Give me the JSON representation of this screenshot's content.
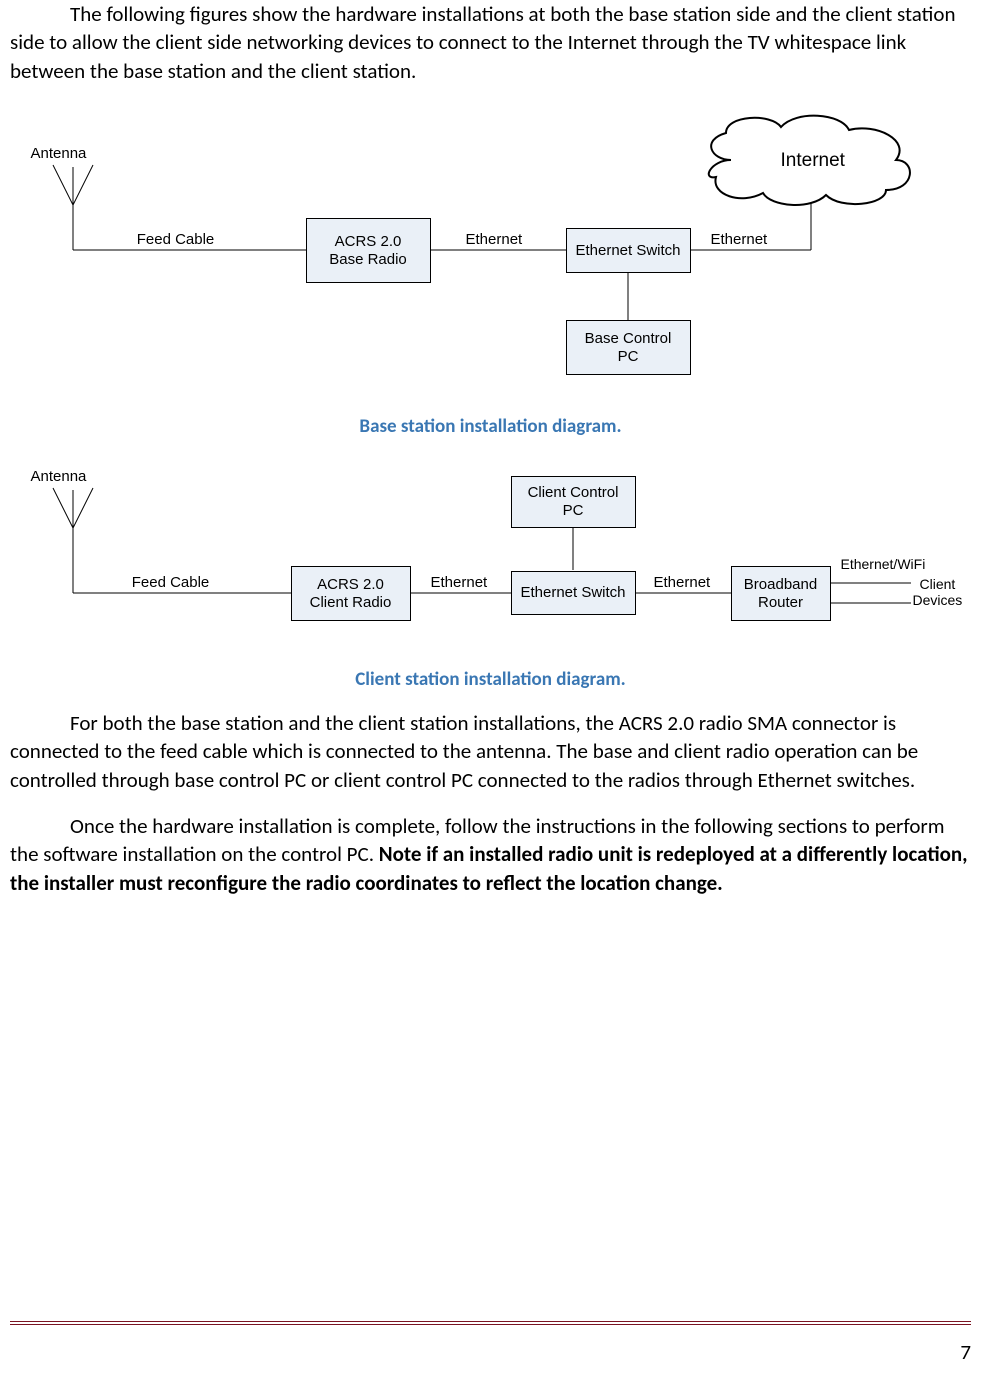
{
  "paragraphs": {
    "p1": "The following figures show the hardware installations at both the base station side and the client station side to allow the client side networking devices to connect to the Internet through the TV whitespace link between the base station and the client station.",
    "p2": "For both the base station and the client station installations, the ACRS 2.0 radio SMA connector is connected to the feed cable which is connected to the antenna. The base and client radio operation can be controlled through base control PC or client control PC connected to the radios through Ethernet switches.",
    "p3_a": "Once the hardware installation is complete, follow the instructions in the following sections to perform the software installation on the control PC. ",
    "p3_b": "Note if an installed radio unit is redeployed at a differently location, the installer must reconfigure the radio coordinates to reflect the location change."
  },
  "captions": {
    "c1": "Base station installation diagram.",
    "c2": "Client station installation diagram."
  },
  "diagram1": {
    "labels": {
      "antenna": "Antenna",
      "feed_cable": "Feed Cable",
      "ethernet1": "Ethernet",
      "ethernet2": "Ethernet",
      "internet": "Internet"
    },
    "nodes": {
      "base_radio": "ACRS 2.0\nBase Radio",
      "eth_switch": "Ethernet Switch",
      "base_pc": "Base Control\nPC"
    }
  },
  "diagram2": {
    "labels": {
      "antenna": "Antenna",
      "feed_cable": "Feed Cable",
      "ethernet1": "Ethernet",
      "ethernet2": "Ethernet",
      "eth_wifi": "Ethernet/WiFi",
      "client_devices": "Client\nDevices"
    },
    "nodes": {
      "client_radio": "ACRS 2.0\nClient Radio",
      "eth_switch": "Ethernet Switch",
      "client_pc": "Client Control\nPC",
      "router": "Broadband\nRouter"
    }
  },
  "page_number": "7"
}
